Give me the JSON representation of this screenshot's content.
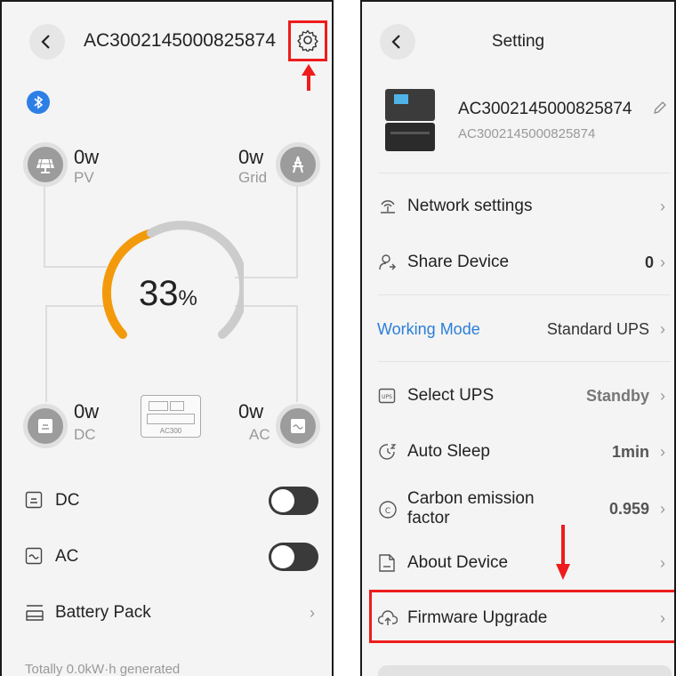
{
  "left": {
    "device_id": "AC3002145000825874",
    "flow": {
      "pv": {
        "value": "0w",
        "label": "PV"
      },
      "grid": {
        "value": "0w",
        "label": "Grid"
      },
      "dc": {
        "value": "0w",
        "label": "DC"
      },
      "ac": {
        "value": "0w",
        "label": "AC"
      },
      "battery_percent": "33",
      "percent_sign": "%",
      "battery_fraction": 0.33,
      "device_model": "AC300"
    },
    "controls": {
      "dc_label": "DC",
      "ac_label": "AC",
      "battery_pack_label": "Battery Pack"
    },
    "footer_text": "Totally 0.0kW·h generated"
  },
  "right": {
    "title": "Setting",
    "device": {
      "name": "AC3002145000825874",
      "serial": "AC3002145000825874"
    },
    "menu": {
      "network": "Network settings",
      "share": "Share Device",
      "share_value": "0",
      "working_mode": "Working Mode",
      "working_mode_value": "Standard UPS",
      "select_ups": "Select UPS",
      "select_ups_value": "Standby",
      "auto_sleep": "Auto Sleep",
      "auto_sleep_value": "1min",
      "carbon_line1": "Carbon emission",
      "carbon_line2": "factor",
      "carbon_value": "0.959",
      "about": "About Device",
      "firmware": "Firmware Upgrade"
    }
  },
  "colors": {
    "highlight": "#ee1c1c",
    "accent_blue": "#2b7fd8",
    "gauge_orange": "#f39a0c",
    "gauge_gray": "#cccccc",
    "bluetooth": "#2d7fe6"
  }
}
